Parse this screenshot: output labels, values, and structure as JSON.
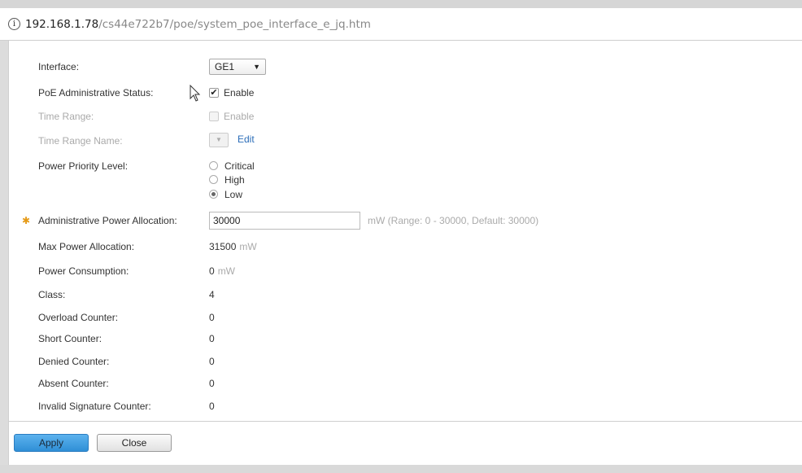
{
  "url": {
    "host": "192.168.1.78",
    "path": "/cs44e722b7/poe/system_poe_interface_e_jq.htm"
  },
  "form": {
    "interface": {
      "label": "Interface:",
      "value": "GE1"
    },
    "poe_admin_status": {
      "label": "PoE Administrative Status:",
      "checked": true,
      "option": "Enable"
    },
    "time_range": {
      "label": "Time Range:",
      "checked": false,
      "option": "Enable",
      "disabled": true
    },
    "time_range_name": {
      "label": "Time Range Name:",
      "edit_label": "Edit",
      "disabled": true
    },
    "power_priority": {
      "label": "Power Priority Level:",
      "options": [
        "Critical",
        "High",
        "Low"
      ],
      "selected": "Low"
    },
    "admin_power_allocation": {
      "label": "Administrative Power Allocation:",
      "value": "30000",
      "hint": "mW (Range: 0 - 30000, Default: 30000)"
    },
    "max_power_allocation": {
      "label": "Max Power Allocation:",
      "value": "31500",
      "unit": "mW"
    },
    "power_consumption": {
      "label": "Power Consumption:",
      "value": "0",
      "unit": "mW"
    },
    "class": {
      "label": "Class:",
      "value": "4"
    },
    "overload_counter": {
      "label": "Overload Counter:",
      "value": "0"
    },
    "short_counter": {
      "label": "Short Counter:",
      "value": "0"
    },
    "denied_counter": {
      "label": "Denied Counter:",
      "value": "0"
    },
    "absent_counter": {
      "label": "Absent Counter:",
      "value": "0"
    },
    "invalid_signature_counter": {
      "label": "Invalid Signature Counter:",
      "value": "0"
    }
  },
  "buttons": {
    "apply": "Apply",
    "close": "Close"
  },
  "icons": {
    "info": "info-circle-icon",
    "required": "required-asterisk-icon",
    "cursor": "mouse-pointer-icon",
    "dropdown": "caret-down-icon"
  },
  "colors": {
    "link": "#2b6db8",
    "apply_button": "#2f8fd6",
    "required": "#e59a17"
  }
}
